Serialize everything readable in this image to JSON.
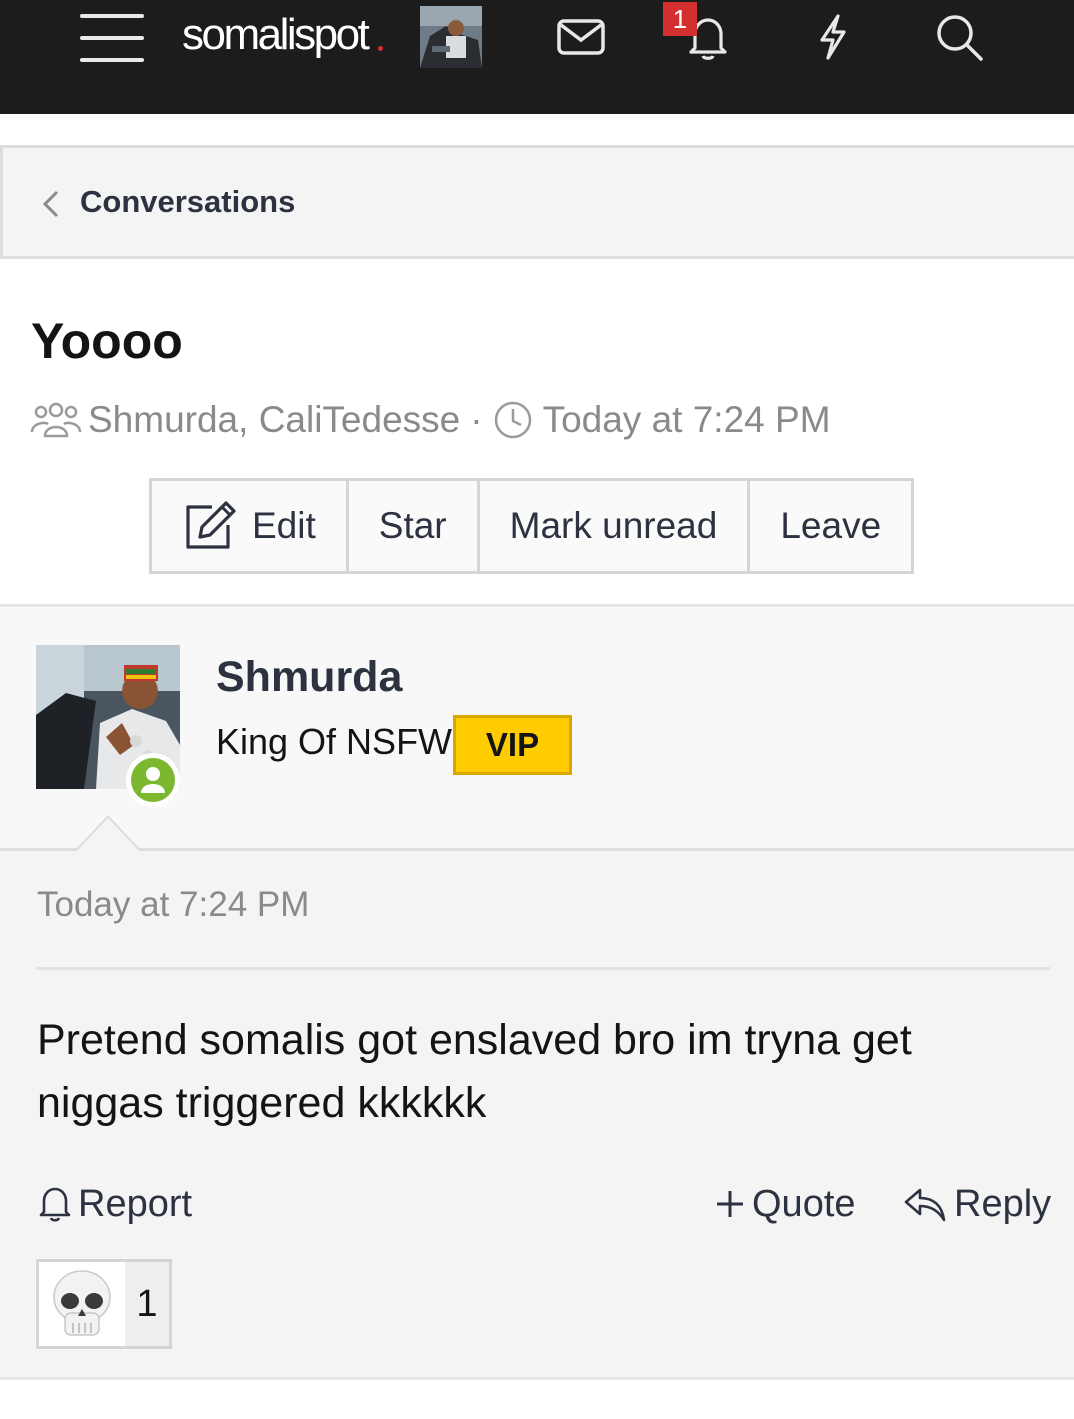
{
  "nav": {
    "logo": "somalispot",
    "notification_count": "1"
  },
  "breadcrumb": {
    "label": "Conversations"
  },
  "conversation": {
    "title": "Yoooo",
    "participants": "Shmurda, CaliTedesse",
    "separator": "·",
    "date": "Today at 7:24 PM",
    "buttons": {
      "edit": "Edit",
      "star": "Star",
      "mark_unread": "Mark unread",
      "leave": "Leave"
    }
  },
  "message": {
    "author": "Shmurda",
    "user_title": "King Of NSFW",
    "badge": "VIP",
    "date": "Today at 7:24 PM",
    "body": "Pretend somalis got enslaved bro im tryna get niggas triggered kkkkkk",
    "actions": {
      "report": "Report",
      "quote": "Quote",
      "reply": "Reply"
    },
    "reaction": {
      "emoji": "💀",
      "count": "1"
    }
  },
  "colors": {
    "topbar": "#1c1c1c",
    "vip_badge": "#ffcc00",
    "online": "#7cb82f",
    "badge_red": "#d32f2f"
  },
  "icons": [
    "menu-icon",
    "user-avatar-icon",
    "envelope-icon",
    "bell-icon",
    "lightning-icon",
    "search-icon",
    "chevron-left-icon",
    "users-icon",
    "clock-icon",
    "edit-icon",
    "report-bell-icon",
    "plus-icon",
    "reply-icon",
    "skull-emoji"
  ]
}
